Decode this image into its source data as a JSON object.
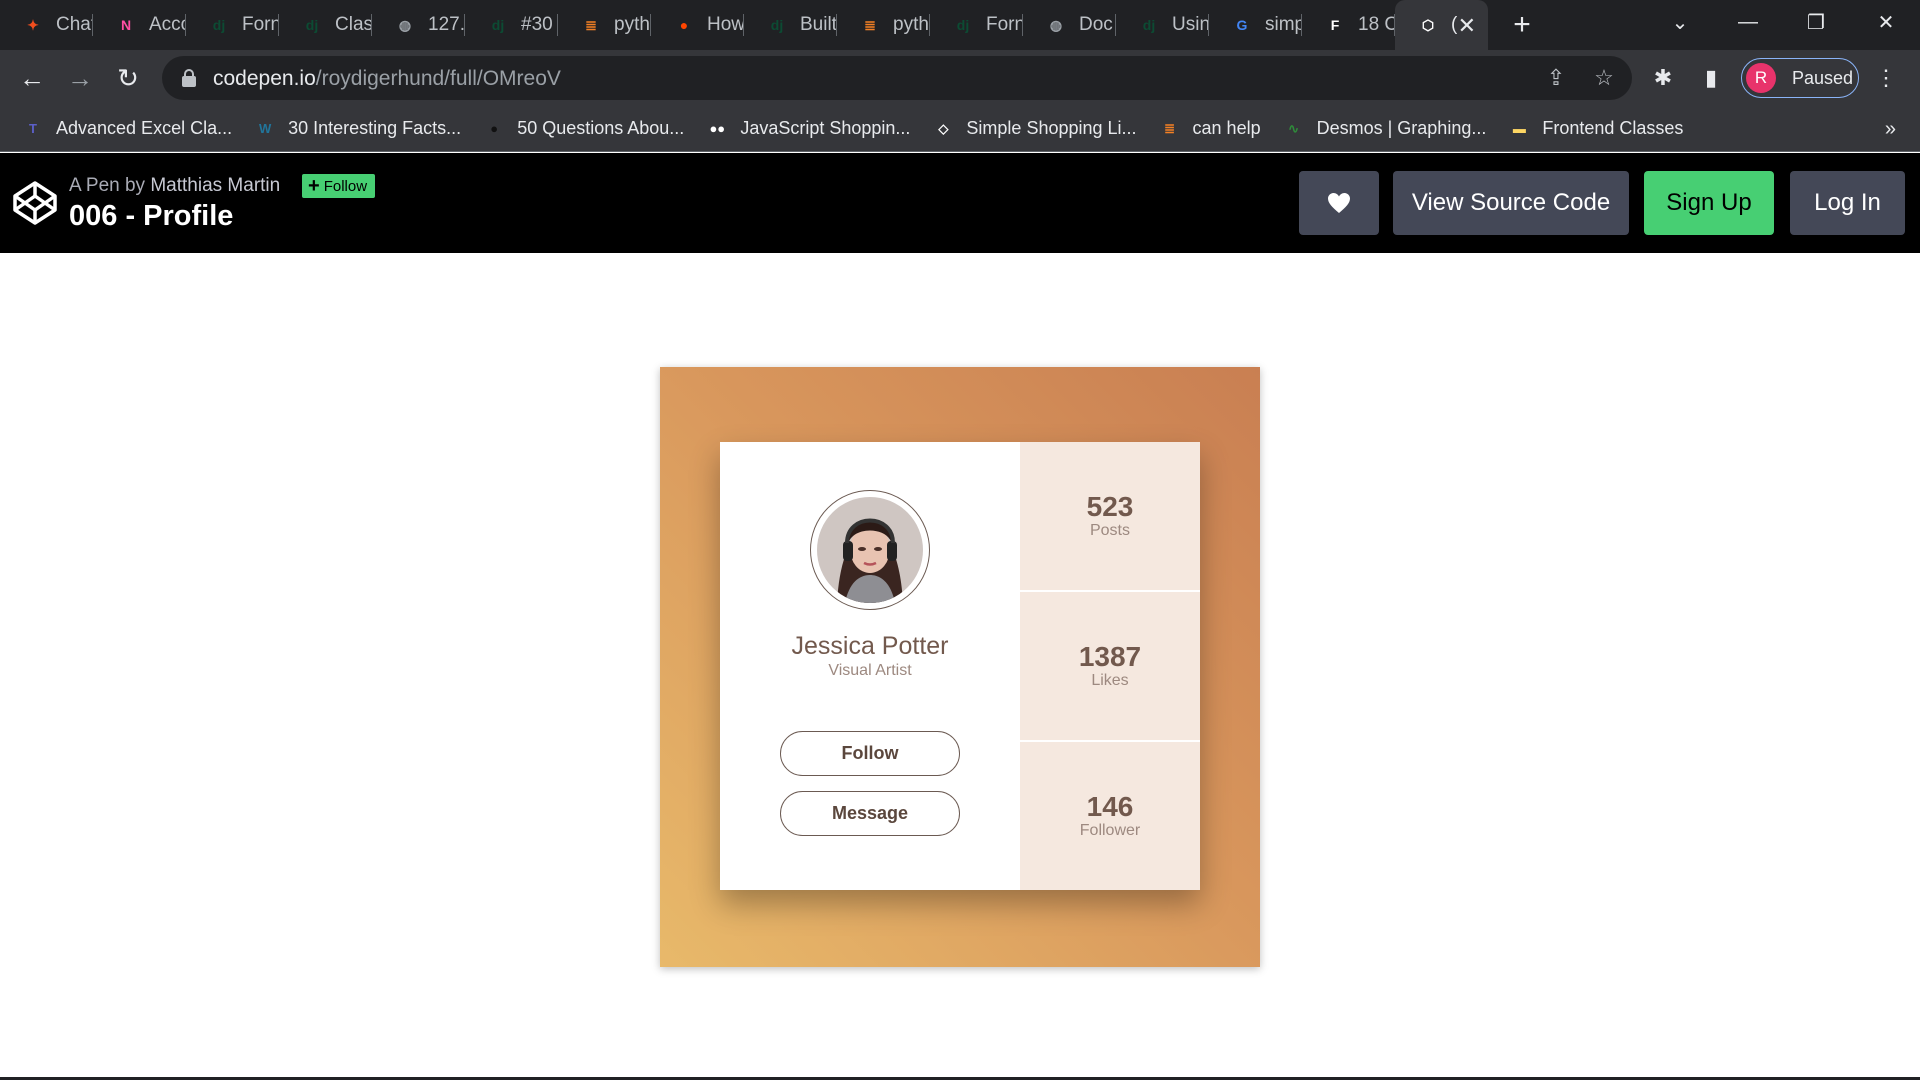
{
  "browser": {
    "tabs": [
      {
        "label": "Chat",
        "icon": "figma-icon",
        "color": "#f24e1e"
      },
      {
        "label": "Acco",
        "icon": "notion-style-icon",
        "color": "#ff4fa3"
      },
      {
        "label": "Forn",
        "icon": "django-icon",
        "color": "#0c4b33"
      },
      {
        "label": "Clas",
        "icon": "django-icon",
        "color": "#0c4b33"
      },
      {
        "label": "127.",
        "icon": "globe-icon",
        "color": "#9aa0a6"
      },
      {
        "label": "#30",
        "icon": "django-icon",
        "color": "#0c4b33"
      },
      {
        "label": "pyth",
        "icon": "stackoverflow-icon",
        "color": "#f48024"
      },
      {
        "label": "How",
        "icon": "reddit-icon",
        "color": "#ff4500"
      },
      {
        "label": "Built",
        "icon": "django-icon",
        "color": "#0c4b33"
      },
      {
        "label": "pyth",
        "icon": "stackoverflow-icon",
        "color": "#f48024"
      },
      {
        "label": "Forn",
        "icon": "django-icon",
        "color": "#0c4b33"
      },
      {
        "label": "Doc",
        "icon": "globe-icon",
        "color": "#9aa0a6"
      },
      {
        "label": "Usin",
        "icon": "django-icon",
        "color": "#0c4b33"
      },
      {
        "label": "simp",
        "icon": "google-icon",
        "color": "#4285f4"
      },
      {
        "label": "18 C",
        "icon": "framer-icon",
        "color": "#ffffff"
      },
      {
        "label": "(",
        "icon": "codepen-icon",
        "color": "#ffffff",
        "active": true
      }
    ],
    "url_host": "codepen.io",
    "url_path": "/roydigerhund/full/OMreoV",
    "profile_initial": "R",
    "profile_status": "Paused",
    "bookmarks": [
      {
        "label": "Advanced Excel Cla...",
        "icon": "teams-icon",
        "color": "#5b5fc7"
      },
      {
        "label": "30 Interesting Facts...",
        "icon": "wordpress-icon",
        "color": "#21759b"
      },
      {
        "label": "50 Questions Abou...",
        "icon": "circle-icon",
        "color": "#111111"
      },
      {
        "label": "JavaScript Shoppin...",
        "icon": "medium-icon",
        "color": "#ffffff"
      },
      {
        "label": "Simple Shopping Li...",
        "icon": "codepen-box-icon",
        "color": "#ffffff"
      },
      {
        "label": "can help",
        "icon": "stackoverflow-icon",
        "color": "#f48024"
      },
      {
        "label": "Desmos | Graphing...",
        "icon": "desmos-icon",
        "color": "#2f8c3a"
      },
      {
        "label": "Frontend Classes",
        "icon": "folder-icon",
        "color": "#fdd663"
      }
    ]
  },
  "codepen": {
    "pen_by_prefix": "A Pen by",
    "author": "Matthias Martin",
    "follow_label": "Follow",
    "title": "006 - Profile",
    "view_source_label": "View Source Code",
    "signup_label": "Sign Up",
    "login_label": "Log In",
    "accent": "#47cf73"
  },
  "profile": {
    "name": "Jessica Potter",
    "role": "Visual Artist",
    "follow_button": "Follow",
    "message_button": "Message",
    "stats": [
      {
        "value": "523",
        "label": "Posts"
      },
      {
        "value": "1387",
        "label": "Likes"
      },
      {
        "value": "146",
        "label": "Follower"
      }
    ]
  }
}
